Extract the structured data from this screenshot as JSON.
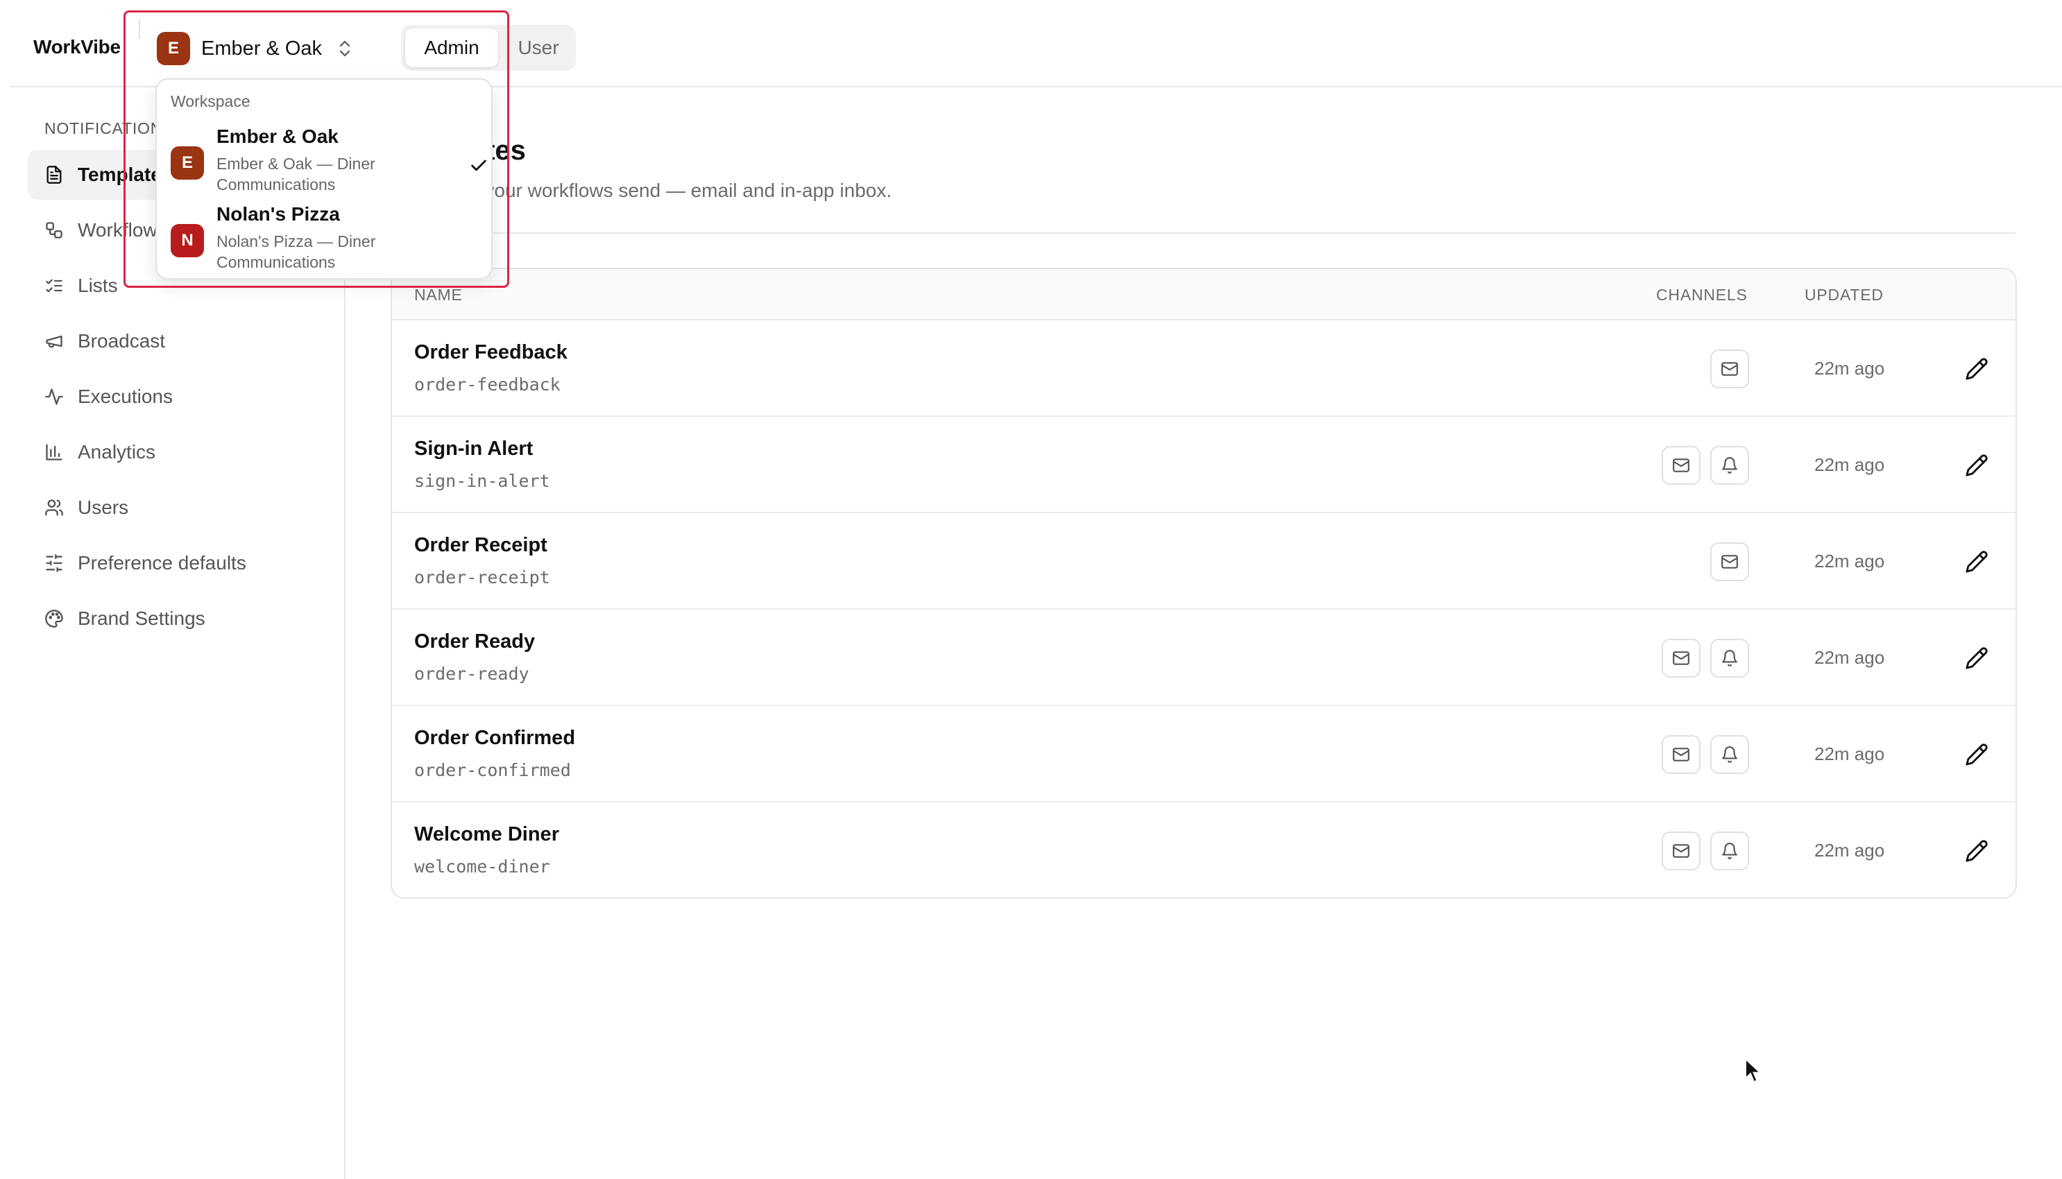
{
  "app": {
    "brand": "WorkVibe"
  },
  "workspace_switcher": {
    "current_initial": "E",
    "current_name": "Ember & Oak"
  },
  "role_toggle": {
    "admin_label": "Admin",
    "user_label": "User",
    "selected": "Admin"
  },
  "sidebar": {
    "heading": "NOTIFICATIONS",
    "items": [
      {
        "label": "Templates",
        "icon": "file-text-icon",
        "active": true
      },
      {
        "label": "Workflows",
        "icon": "workflow-icon"
      },
      {
        "label": "Lists",
        "icon": "list-checks-icon"
      },
      {
        "label": "Broadcast",
        "icon": "megaphone-icon"
      },
      {
        "label": "Executions",
        "icon": "activity-icon"
      },
      {
        "label": "Analytics",
        "icon": "bar-chart-icon"
      },
      {
        "label": "Users",
        "icon": "users-icon"
      },
      {
        "label": "Preference defaults",
        "icon": "sliders-icon"
      },
      {
        "label": "Brand Settings",
        "icon": "palette-icon"
      }
    ]
  },
  "main": {
    "title": "Templates",
    "subtitle": "Messages your workflows send — email and in-app inbox."
  },
  "table": {
    "headers": {
      "name": "NAME",
      "channels": "CHANNELS",
      "updated": "UPDATED"
    },
    "rows": [
      {
        "name": "Order Feedback",
        "slug": "order-feedback",
        "channels": [
          "email"
        ],
        "updated": "22m ago"
      },
      {
        "name": "Sign-in Alert",
        "slug": "sign-in-alert",
        "channels": [
          "email",
          "in-app"
        ],
        "updated": "22m ago"
      },
      {
        "name": "Order Receipt",
        "slug": "order-receipt",
        "channels": [
          "email"
        ],
        "updated": "22m ago"
      },
      {
        "name": "Order Ready",
        "slug": "order-ready",
        "channels": [
          "email",
          "in-app"
        ],
        "updated": "22m ago"
      },
      {
        "name": "Order Confirmed",
        "slug": "order-confirmed",
        "channels": [
          "email",
          "in-app"
        ],
        "updated": "22m ago"
      },
      {
        "name": "Welcome Diner",
        "slug": "welcome-diner",
        "channels": [
          "email",
          "in-app"
        ],
        "updated": "22m ago"
      }
    ]
  },
  "dropdown": {
    "label": "Workspace",
    "items": [
      {
        "initial": "E",
        "name": "Ember & Oak",
        "description": "Ember & Oak — Diner Communications",
        "selected": true,
        "color": "#9a3412"
      },
      {
        "initial": "N",
        "name": "Nolan's Pizza",
        "description": "Nolan's Pizza — Diner Communications",
        "selected": false,
        "color": "#b91c1c"
      }
    ]
  },
  "colors": {
    "highlight": "#dc2645",
    "ember_avatar": "#9a3412",
    "nolan_avatar": "#b91c1c"
  }
}
